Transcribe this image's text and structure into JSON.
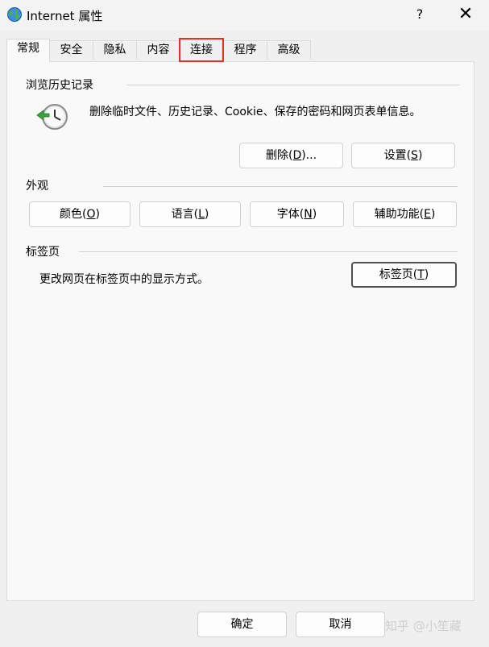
{
  "window": {
    "title": "Internet 属性",
    "help": "?",
    "close": "✕"
  },
  "tabs": [
    {
      "label": "常规",
      "active": true
    },
    {
      "label": "安全"
    },
    {
      "label": "隐私"
    },
    {
      "label": "内容"
    },
    {
      "label": "连接",
      "highlighted": true
    },
    {
      "label": "程序"
    },
    {
      "label": "高级"
    }
  ],
  "history": {
    "label": "浏览历史记录",
    "description": "删除临时文件、历史记录、Cookie、保存的密码和网页表单信息。",
    "delete_button": {
      "text": "删除(",
      "key": "D",
      "suffix": ")..."
    },
    "settings_button": {
      "text": "设置(",
      "key": "S",
      "suffix": ")"
    }
  },
  "appearance": {
    "label": "外观",
    "buttons": [
      {
        "text": "颜色(",
        "key": "O",
        "suffix": ")"
      },
      {
        "text": "语言(",
        "key": "L",
        "suffix": ")"
      },
      {
        "text": "字体(",
        "key": "N",
        "suffix": ")"
      },
      {
        "text": "辅助功能(",
        "key": "E",
        "suffix": ")"
      }
    ]
  },
  "tab_group": {
    "label": "标签页",
    "description": "更改网页在标签页中的显示方式。",
    "button": {
      "text": "标签页(",
      "key": "T",
      "suffix": ")"
    }
  },
  "footer": {
    "ok": "确定",
    "cancel": "取消",
    "watermark": "知乎 @小笙藏"
  },
  "colors": {
    "highlight": "#e23222"
  }
}
